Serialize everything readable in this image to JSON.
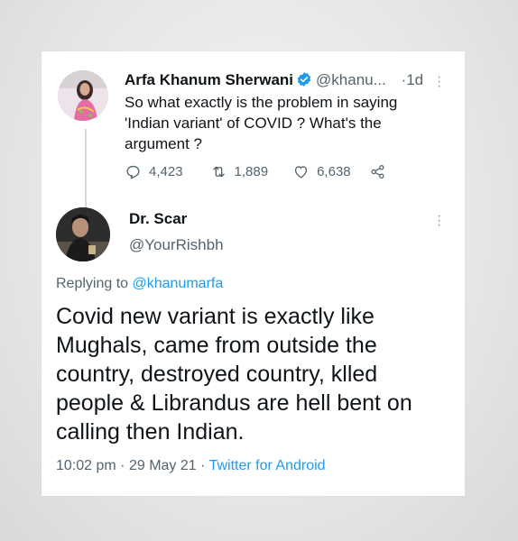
{
  "tweet1": {
    "author_name": "Arfa Khanum Sherwani",
    "handle": "@khanu...",
    "separator": "·",
    "time": "1d",
    "text_lines": [
      "So what exactly is the problem in saying",
      "'Indian variant' of COVID ? What's the",
      "argument ?"
    ],
    "reply_count": "4,423",
    "retweet_count": "1,889",
    "like_count": "6,638"
  },
  "tweet2": {
    "author_name": "Dr. Scar",
    "handle": "@YourRishbh",
    "replying_prefix": "Replying to",
    "replying_to": "@khanumarfa",
    "text_lines": [
      "Covid new variant is exactly like",
      "Mughals, came from outside the",
      "country, destroyed country, klled",
      "people & Librandus are hell bent on",
      "calling then Indian."
    ],
    "time": "10:02 pm",
    "date": "29 May 21",
    "dot": "·",
    "source": "Twitter for Android"
  },
  "icons": {
    "verified": "verified-badge-icon",
    "reply": "reply-icon",
    "retweet": "retweet-icon",
    "like": "heart-icon",
    "share": "share-icon",
    "more": "more-options-icon"
  },
  "colors": {
    "link_blue": "#1d9bf0",
    "muted_gray": "#536471",
    "text": "#0f1419"
  }
}
